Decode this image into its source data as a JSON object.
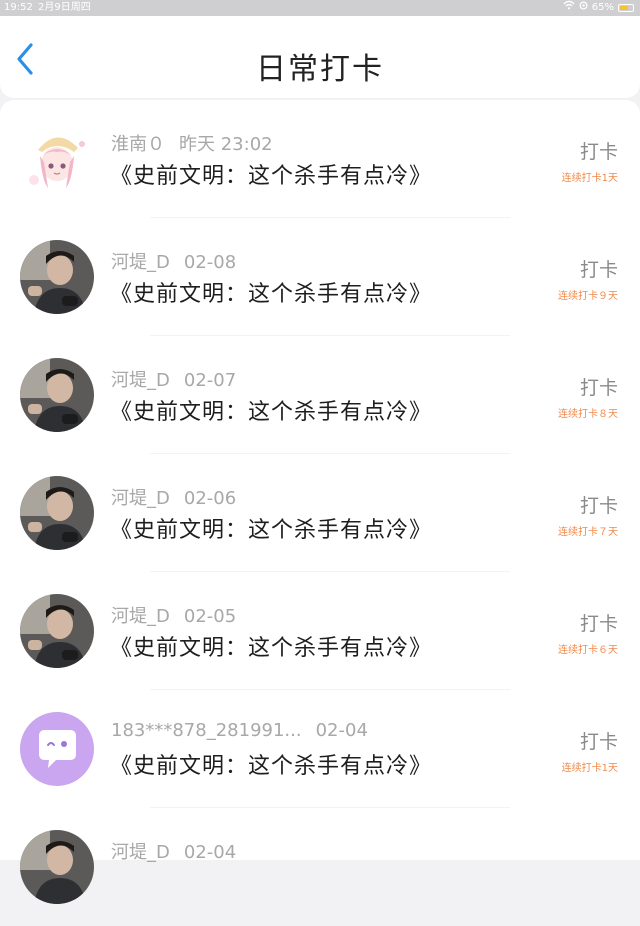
{
  "status_bar": {
    "time": "19:52",
    "date": "2月9日周四",
    "battery": "65%",
    "battery_level": 0.65
  },
  "header": {
    "title": "日常打卡"
  },
  "entries": [
    {
      "name": "淮南０",
      "time": "昨天 23:02",
      "content": "《史前文明：这个杀手有点冷》",
      "action": "打卡",
      "streak": "连续打卡1天",
      "avatar": "anime-girl"
    },
    {
      "name": "河堤_D",
      "time": "02-08",
      "content": "《史前文明：这个杀手有点冷》",
      "action": "打卡",
      "streak": "连续打卡９天",
      "avatar": "person-photo"
    },
    {
      "name": "河堤_D",
      "time": "02-07",
      "content": "《史前文明：这个杀手有点冷》",
      "action": "打卡",
      "streak": "连续打卡８天",
      "avatar": "person-photo"
    },
    {
      "name": "河堤_D",
      "time": "02-06",
      "content": "《史前文明：这个杀手有点冷》",
      "action": "打卡",
      "streak": "连续打卡７天",
      "avatar": "person-photo"
    },
    {
      "name": "河堤_D",
      "time": "02-05",
      "content": "《史前文明：这个杀手有点冷》",
      "action": "打卡",
      "streak": "连续打卡６天",
      "avatar": "person-photo"
    },
    {
      "name": "183***878_281991...",
      "time": "02-04",
      "content": "《史前文明：这个杀手有点冷》",
      "action": "打卡",
      "streak": "连续打卡1天",
      "avatar": "default-chat"
    },
    {
      "name": "河堤_D",
      "time": "02-04",
      "content": "",
      "action": "",
      "streak": "",
      "avatar": "person-photo"
    }
  ],
  "colors": {
    "accent_blue": "#2b8fe8",
    "streak_orange": "#f08a4b",
    "default_avatar": "#c9a6ef"
  }
}
